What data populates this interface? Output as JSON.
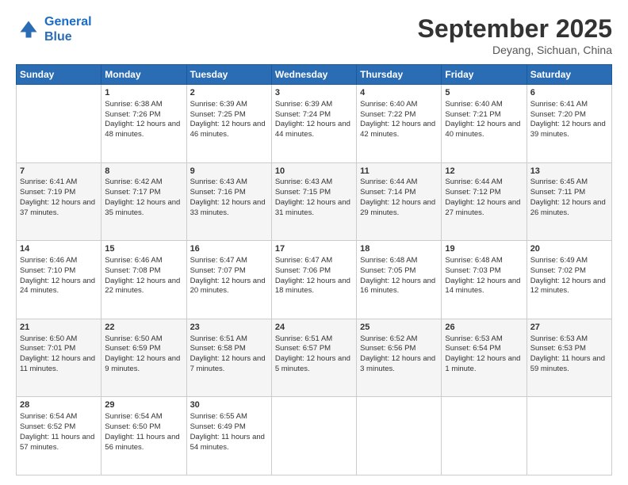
{
  "logo": {
    "line1": "General",
    "line2": "Blue"
  },
  "title": "September 2025",
  "location": "Deyang, Sichuan, China",
  "days_of_week": [
    "Sunday",
    "Monday",
    "Tuesday",
    "Wednesday",
    "Thursday",
    "Friday",
    "Saturday"
  ],
  "weeks": [
    [
      {
        "day": "",
        "sunrise": "",
        "sunset": "",
        "daylight": ""
      },
      {
        "day": "1",
        "sunrise": "Sunrise: 6:38 AM",
        "sunset": "Sunset: 7:26 PM",
        "daylight": "Daylight: 12 hours and 48 minutes."
      },
      {
        "day": "2",
        "sunrise": "Sunrise: 6:39 AM",
        "sunset": "Sunset: 7:25 PM",
        "daylight": "Daylight: 12 hours and 46 minutes."
      },
      {
        "day": "3",
        "sunrise": "Sunrise: 6:39 AM",
        "sunset": "Sunset: 7:24 PM",
        "daylight": "Daylight: 12 hours and 44 minutes."
      },
      {
        "day": "4",
        "sunrise": "Sunrise: 6:40 AM",
        "sunset": "Sunset: 7:22 PM",
        "daylight": "Daylight: 12 hours and 42 minutes."
      },
      {
        "day": "5",
        "sunrise": "Sunrise: 6:40 AM",
        "sunset": "Sunset: 7:21 PM",
        "daylight": "Daylight: 12 hours and 40 minutes."
      },
      {
        "day": "6",
        "sunrise": "Sunrise: 6:41 AM",
        "sunset": "Sunset: 7:20 PM",
        "daylight": "Daylight: 12 hours and 39 minutes."
      }
    ],
    [
      {
        "day": "7",
        "sunrise": "Sunrise: 6:41 AM",
        "sunset": "Sunset: 7:19 PM",
        "daylight": "Daylight: 12 hours and 37 minutes."
      },
      {
        "day": "8",
        "sunrise": "Sunrise: 6:42 AM",
        "sunset": "Sunset: 7:17 PM",
        "daylight": "Daylight: 12 hours and 35 minutes."
      },
      {
        "day": "9",
        "sunrise": "Sunrise: 6:43 AM",
        "sunset": "Sunset: 7:16 PM",
        "daylight": "Daylight: 12 hours and 33 minutes."
      },
      {
        "day": "10",
        "sunrise": "Sunrise: 6:43 AM",
        "sunset": "Sunset: 7:15 PM",
        "daylight": "Daylight: 12 hours and 31 minutes."
      },
      {
        "day": "11",
        "sunrise": "Sunrise: 6:44 AM",
        "sunset": "Sunset: 7:14 PM",
        "daylight": "Daylight: 12 hours and 29 minutes."
      },
      {
        "day": "12",
        "sunrise": "Sunrise: 6:44 AM",
        "sunset": "Sunset: 7:12 PM",
        "daylight": "Daylight: 12 hours and 27 minutes."
      },
      {
        "day": "13",
        "sunrise": "Sunrise: 6:45 AM",
        "sunset": "Sunset: 7:11 PM",
        "daylight": "Daylight: 12 hours and 26 minutes."
      }
    ],
    [
      {
        "day": "14",
        "sunrise": "Sunrise: 6:46 AM",
        "sunset": "Sunset: 7:10 PM",
        "daylight": "Daylight: 12 hours and 24 minutes."
      },
      {
        "day": "15",
        "sunrise": "Sunrise: 6:46 AM",
        "sunset": "Sunset: 7:08 PM",
        "daylight": "Daylight: 12 hours and 22 minutes."
      },
      {
        "day": "16",
        "sunrise": "Sunrise: 6:47 AM",
        "sunset": "Sunset: 7:07 PM",
        "daylight": "Daylight: 12 hours and 20 minutes."
      },
      {
        "day": "17",
        "sunrise": "Sunrise: 6:47 AM",
        "sunset": "Sunset: 7:06 PM",
        "daylight": "Daylight: 12 hours and 18 minutes."
      },
      {
        "day": "18",
        "sunrise": "Sunrise: 6:48 AM",
        "sunset": "Sunset: 7:05 PM",
        "daylight": "Daylight: 12 hours and 16 minutes."
      },
      {
        "day": "19",
        "sunrise": "Sunrise: 6:48 AM",
        "sunset": "Sunset: 7:03 PM",
        "daylight": "Daylight: 12 hours and 14 minutes."
      },
      {
        "day": "20",
        "sunrise": "Sunrise: 6:49 AM",
        "sunset": "Sunset: 7:02 PM",
        "daylight": "Daylight: 12 hours and 12 minutes."
      }
    ],
    [
      {
        "day": "21",
        "sunrise": "Sunrise: 6:50 AM",
        "sunset": "Sunset: 7:01 PM",
        "daylight": "Daylight: 12 hours and 11 minutes."
      },
      {
        "day": "22",
        "sunrise": "Sunrise: 6:50 AM",
        "sunset": "Sunset: 6:59 PM",
        "daylight": "Daylight: 12 hours and 9 minutes."
      },
      {
        "day": "23",
        "sunrise": "Sunrise: 6:51 AM",
        "sunset": "Sunset: 6:58 PM",
        "daylight": "Daylight: 12 hours and 7 minutes."
      },
      {
        "day": "24",
        "sunrise": "Sunrise: 6:51 AM",
        "sunset": "Sunset: 6:57 PM",
        "daylight": "Daylight: 12 hours and 5 minutes."
      },
      {
        "day": "25",
        "sunrise": "Sunrise: 6:52 AM",
        "sunset": "Sunset: 6:56 PM",
        "daylight": "Daylight: 12 hours and 3 minutes."
      },
      {
        "day": "26",
        "sunrise": "Sunrise: 6:53 AM",
        "sunset": "Sunset: 6:54 PM",
        "daylight": "Daylight: 12 hours and 1 minute."
      },
      {
        "day": "27",
        "sunrise": "Sunrise: 6:53 AM",
        "sunset": "Sunset: 6:53 PM",
        "daylight": "Daylight: 11 hours and 59 minutes."
      }
    ],
    [
      {
        "day": "28",
        "sunrise": "Sunrise: 6:54 AM",
        "sunset": "Sunset: 6:52 PM",
        "daylight": "Daylight: 11 hours and 57 minutes."
      },
      {
        "day": "29",
        "sunrise": "Sunrise: 6:54 AM",
        "sunset": "Sunset: 6:50 PM",
        "daylight": "Daylight: 11 hours and 56 minutes."
      },
      {
        "day": "30",
        "sunrise": "Sunrise: 6:55 AM",
        "sunset": "Sunset: 6:49 PM",
        "daylight": "Daylight: 11 hours and 54 minutes."
      },
      {
        "day": "",
        "sunrise": "",
        "sunset": "",
        "daylight": ""
      },
      {
        "day": "",
        "sunrise": "",
        "sunset": "",
        "daylight": ""
      },
      {
        "day": "",
        "sunrise": "",
        "sunset": "",
        "daylight": ""
      },
      {
        "day": "",
        "sunrise": "",
        "sunset": "",
        "daylight": ""
      }
    ]
  ]
}
